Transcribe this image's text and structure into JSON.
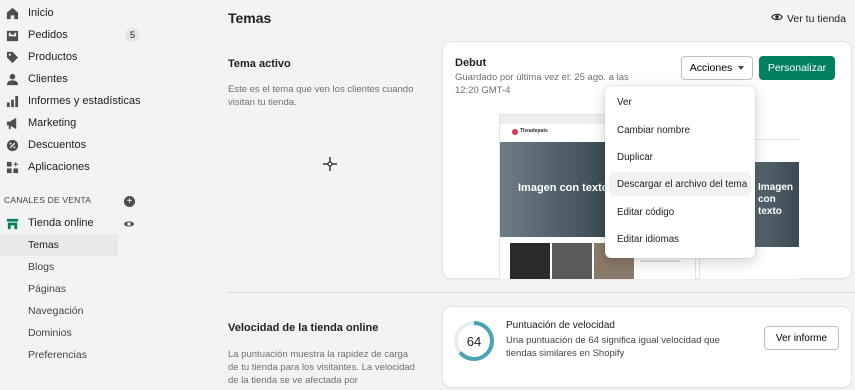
{
  "sidebar": {
    "items": [
      {
        "label": "Inicio",
        "icon": "home-icon"
      },
      {
        "label": "Pedidos",
        "icon": "orders-icon",
        "badge": "5"
      },
      {
        "label": "Productos",
        "icon": "tag-icon"
      },
      {
        "label": "Clientes",
        "icon": "person-icon"
      },
      {
        "label": "Informes y estadísticas",
        "icon": "bar-chart-icon"
      },
      {
        "label": "Marketing",
        "icon": "megaphone-icon"
      },
      {
        "label": "Descuentos",
        "icon": "discount-icon"
      },
      {
        "label": "Aplicaciones",
        "icon": "apps-icon"
      }
    ],
    "sales_channels_title": "CANALES DE VENTA",
    "online_store": "Tienda online",
    "sub_items": [
      "Temas",
      "Blogs",
      "Páginas",
      "Navegación",
      "Dominios",
      "Preferencias"
    ]
  },
  "header": {
    "title": "Temas",
    "view_store": "Ver tu tienda"
  },
  "active_theme_section": {
    "heading": "Tema activo",
    "description": "Este es el tema que ven los clientes cuando visitan tu tienda."
  },
  "theme_card": {
    "name": "Debut",
    "saved": "Guardado por última vez el: 25 ago. a las 12:20 GMT-4",
    "actions_label": "Acciones",
    "customize_label": "Personalizar",
    "preview_brand": "Theadepats",
    "preview_hero_desktop": "Imagen con texto",
    "preview_hero_mobile": "Imagen con texto"
  },
  "actions_menu": {
    "items": [
      "Ver",
      "Cambiar nombre",
      "Duplicar",
      "Descargar el archivo del tema",
      "Editar código",
      "Editar idiomas"
    ]
  },
  "speed_section": {
    "heading": "Velocidad de la tienda online",
    "description": "La puntuación muestra la rapidez de carga de tu tienda para los visitantes. La velocidad de la tienda se ve afectada por"
  },
  "speed_card": {
    "score": "64",
    "score_fraction": 0.64,
    "title": "Puntuación de velocidad",
    "description": "Una puntuación de 64 significa igual velocidad que tiendas similares en Shopify",
    "report_label": "Ver informe"
  },
  "colors": {
    "primary": "#008060",
    "score_ring": "#4aa4b4"
  }
}
